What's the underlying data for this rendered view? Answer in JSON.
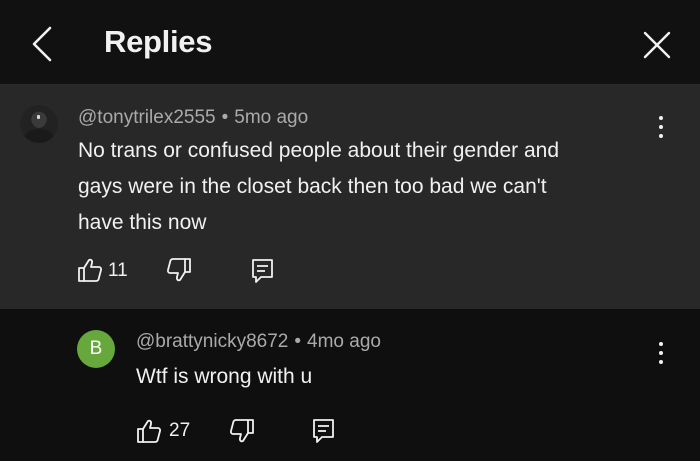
{
  "header": {
    "title": "Replies",
    "back_icon": "chevron-left-icon",
    "close_icon": "close-icon"
  },
  "comments": [
    {
      "handle": "@tonytrilex2555",
      "separator": "•",
      "time": "5mo ago",
      "text_lines": [
        "No trans or confused people about their gender and",
        "gays were in the closet back then too bad we can't",
        "have this now"
      ],
      "like_count": "11",
      "avatar": "profile-photo"
    },
    {
      "handle": "@brattynicky8672",
      "separator": "•",
      "time": "4mo ago",
      "text_lines": [
        "Wtf is wrong with u"
      ],
      "like_count": "27",
      "avatar_letter": "B",
      "avatar_color": "#66a83c"
    }
  ],
  "colors": {
    "background": "#0f0f0f",
    "highlight_background": "#282828",
    "primary_text": "#f1f1f1",
    "secondary_text": "#aaaaaa"
  }
}
